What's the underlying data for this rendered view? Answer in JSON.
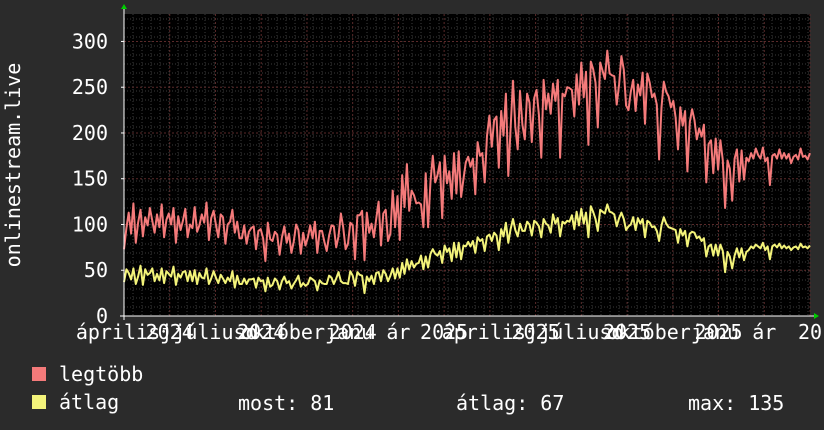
{
  "colors": {
    "background": "#2b2b2b",
    "plot_background": "#000000",
    "grid": "#5a2a2a",
    "grid_dots": "#3c3c3c",
    "axis": "#ffffff",
    "arrow": "#00cc00",
    "series_max": "#f47a7a",
    "series_avg": "#f3f37a"
  },
  "chart_data": {
    "type": "line",
    "ylabel": "onlinestream.live",
    "ylim": [
      0,
      330
    ],
    "yticks": [
      0,
      50,
      100,
      150,
      200,
      250,
      300
    ],
    "xtick_labels": [
      "áprilisj",
      "2024",
      "júliuso",
      "2024",
      "októberjanu",
      "2024",
      "ár",
      "2025",
      "áprilisj",
      "2025",
      "júliuso",
      "2025",
      "októberjanu",
      "2025",
      "ár",
      "20"
    ],
    "x_range": [
      0,
      495
    ],
    "series": [
      {
        "name": "legtöbb",
        "key": "max",
        "values": [
          73,
          96,
          113,
          90,
          123,
          80,
          102,
          116,
          87,
          108,
          99,
          118,
          104,
          91,
          111,
          97,
          122,
          86,
          105,
          112,
          100,
          118,
          80,
          109,
          94,
          104,
          117,
          86,
          100,
          96,
          119,
          92,
          99,
          111,
          102,
          124,
          83,
          107,
          115,
          100,
          86,
          111,
          108,
          79,
          100,
          103,
          116,
          91,
          103,
          85,
          85,
          99,
          79,
          92,
          96,
          98,
          73,
          93,
          95,
          85,
          60,
          102,
          84,
          82,
          92,
          89,
          67,
          86,
          98,
          80,
          90,
          69,
          81,
          100,
          94,
          68,
          91,
          77,
          86,
          99,
          85,
          103,
          69,
          93,
          93,
          81,
          71,
          88,
          99,
          98,
          75,
          87,
          112,
          97,
          73,
          79,
          102,
          99,
          62,
          110,
          110,
          115,
          61,
          113,
          91,
          101,
          86,
          106,
          125,
          77,
          112,
          116,
          82,
          90,
          137,
          97,
          131,
          83,
          154,
          119,
          166,
          115,
          137,
          132,
          123,
          124,
          122,
          97,
          156,
          97,
          147,
          175,
          146,
          154,
          168,
          107,
          175,
          145,
          158,
          128,
          178,
          134,
          180,
          130,
          150,
          168,
          174,
          163,
          172,
          133,
          190,
          175,
          178,
          146,
          197,
          219,
          185,
          214,
          218,
          162,
          224,
          197,
          243,
          153,
          205,
          257,
          207,
          182,
          246,
          209,
          193,
          243,
          233,
          190,
          238,
          247,
          220,
          173,
          258,
          226,
          243,
          221,
          254,
          235,
          258,
          173,
          243,
          240,
          250,
          249,
          247,
          218,
          264,
          231,
          277,
          239,
          267,
          187,
          278,
          270,
          255,
          206,
          277,
          268,
          259,
          290,
          265,
          263,
          262,
          231,
          253,
          284,
          269,
          230,
          225,
          245,
          258,
          224,
          253,
          241,
          266,
          210,
          265,
          255,
          239,
          243,
          231,
          171,
          228,
          256,
          245,
          240,
          228,
          235,
          217,
          182,
          228,
          208,
          224,
          158,
          212,
          226,
          214,
          193,
          205,
          196,
          209,
          146,
          188,
          192,
          156,
          194,
          160,
          192,
          170,
          118,
          170,
          161,
          126,
          172,
          182,
          147,
          181,
          149,
          173,
          169,
          178,
          172,
          183,
          176,
          172,
          184,
          169,
          173,
          143,
          175,
          177,
          172,
          182,
          172,
          178,
          172,
          177,
          167,
          174,
          176,
          171,
          183,
          174,
          175,
          171,
          178
        ],
        "point_labels": [
          "most: 81 (legtöbb)"
        ]
      },
      {
        "name": "átlag",
        "key": "avg",
        "values": [
          37,
          51,
          47,
          40,
          52,
          35,
          43,
          55,
          34,
          51,
          45,
          47,
          52,
          38,
          46,
          39,
          52,
          36,
          49,
          46,
          43,
          54,
          34,
          46,
          42,
          48,
          49,
          38,
          49,
          38,
          50,
          35,
          47,
          42,
          41,
          52,
          35,
          41,
          49,
          42,
          36,
          45,
          41,
          36,
          42,
          38,
          49,
          31,
          44,
          35,
          35,
          41,
          35,
          40,
          40,
          41,
          31,
          42,
          38,
          39,
          27,
          42,
          32,
          34,
          41,
          38,
          29,
          38,
          43,
          36,
          38,
          30,
          35,
          39,
          44,
          32,
          36,
          33,
          35,
          42,
          40,
          38,
          28,
          39,
          36,
          35,
          35,
          44,
          42,
          35,
          41,
          48,
          38,
          36,
          36,
          35,
          49,
          44,
          33,
          48,
          45,
          44,
          25,
          43,
          38,
          44,
          35,
          47,
          48,
          38,
          50,
          46,
          38,
          44,
          52,
          41,
          52,
          42,
          58,
          46,
          62,
          51,
          60,
          53,
          57,
          58,
          66,
          51,
          65,
          53,
          68,
          73,
          68,
          66,
          71,
          58,
          77,
          70,
          74,
          60,
          80,
          64,
          80,
          62,
          77,
          76,
          81,
          76,
          82,
          69,
          86,
          82,
          84,
          71,
          87,
          89,
          82,
          91,
          88,
          72,
          95,
          87,
          102,
          80,
          95,
          106,
          94,
          87,
          101,
          93,
          93,
          103,
          100,
          88,
          104,
          102,
          98,
          86,
          106,
          101,
          99,
          91,
          111,
          101,
          107,
          87,
          103,
          101,
          104,
          103,
          110,
          95,
          114,
          99,
          117,
          101,
          113,
          86,
          120,
          114,
          106,
          93,
          116,
          114,
          112,
          122,
          114,
          113,
          111,
          98,
          107,
          113,
          106,
          94,
          98,
          100,
          108,
          94,
          107,
          101,
          106,
          86,
          104,
          102,
          97,
          98,
          93,
          82,
          99,
          108,
          101,
          97,
          96,
          95,
          94,
          80,
          95,
          88,
          93,
          76,
          90,
          92,
          91,
          85,
          87,
          82,
          85,
          65,
          76,
          78,
          66,
          78,
          66,
          78,
          71,
          48,
          70,
          65,
          52,
          66,
          74,
          64,
          74,
          61,
          70,
          72,
          76,
          74,
          78,
          76,
          74,
          80,
          72,
          76,
          62,
          76,
          78,
          75,
          79,
          74,
          77,
          74,
          76,
          72,
          75,
          76,
          73,
          79,
          75,
          76,
          74,
          77
        ]
      }
    ],
    "stats_labels": {
      "current": "most: 81",
      "average": "átlag: 67",
      "maximum": "max: 135"
    },
    "grid": true,
    "legend_position": "bottom-left"
  },
  "legend": {
    "items": [
      {
        "label": "legtöbb",
        "color_key": "series_max"
      },
      {
        "label": "átlag",
        "color_key": "series_avg"
      }
    ]
  },
  "stats": {
    "current": "most: 81",
    "average": "átlag: 67",
    "maximum": "max: 135"
  }
}
